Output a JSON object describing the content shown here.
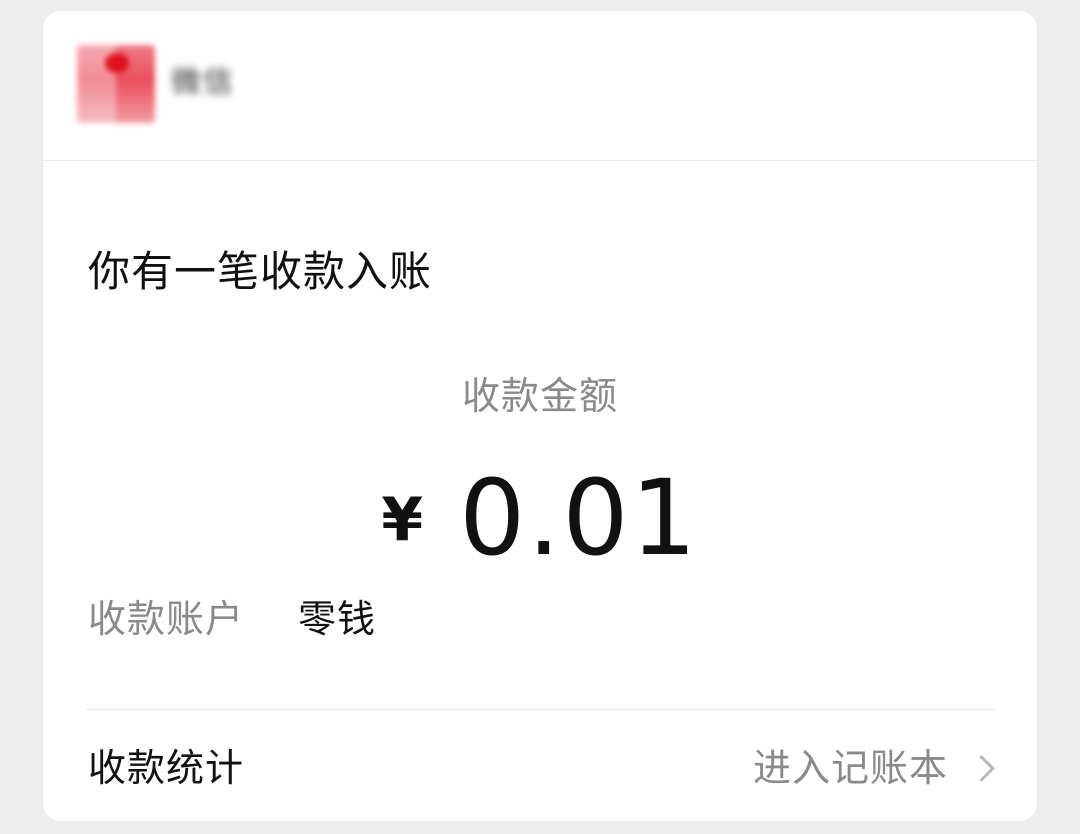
{
  "header": {
    "name": "微信"
  },
  "notice": {
    "title": "你有一笔收款入账"
  },
  "amount": {
    "label": "收款金额",
    "currency": "¥",
    "value": "0.01"
  },
  "account": {
    "label": "收款账户",
    "value": "零钱"
  },
  "stats": {
    "label": "收款统计",
    "link": "进入记账本",
    "link_icon": "chevron-right-icon"
  },
  "colors": {
    "background": "#ededed",
    "card": "#ffffff",
    "primary_text": "#111111",
    "secondary_text": "#8a8a8a",
    "divider": "#e6e6e6"
  }
}
